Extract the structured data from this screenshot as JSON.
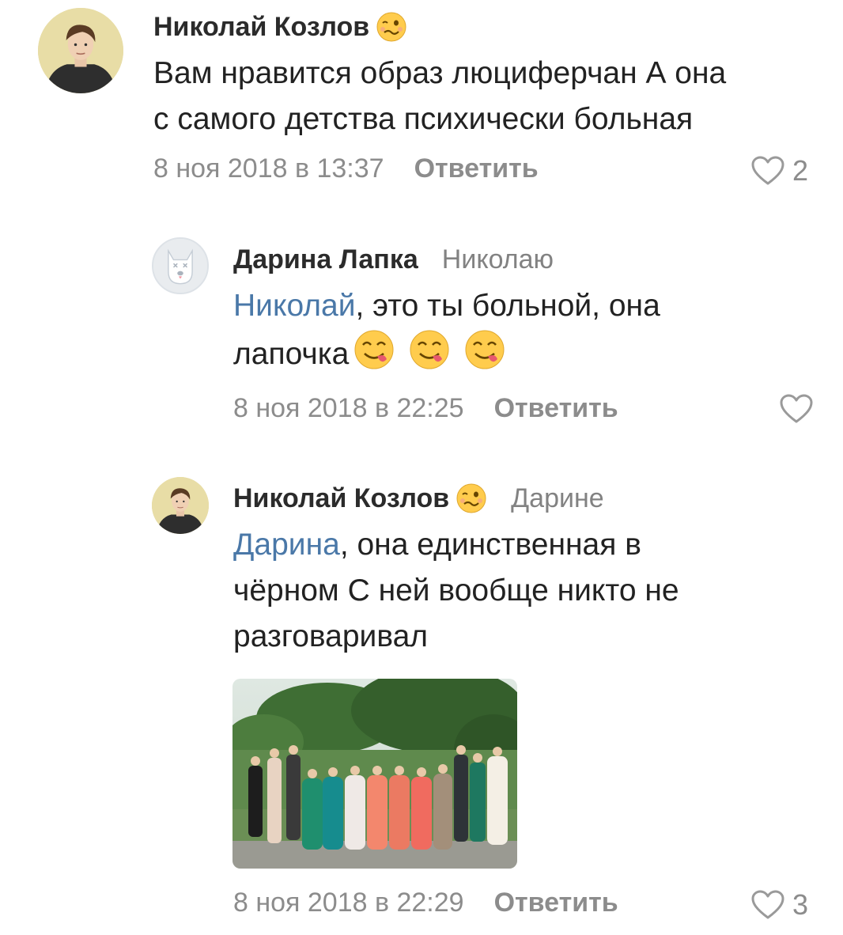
{
  "comments": [
    {
      "author": "Николай Козлов",
      "status_emoji": "woozy-face-emoji",
      "reply_to": "",
      "text_lines": [
        "Вам нравится образ люциферчан А она",
        "с самого детства психически больная"
      ],
      "date": "8 ноя 2018 в 13:37",
      "reply_label": "Ответить",
      "likes": "2"
    },
    {
      "author": "Дарина Лапка",
      "reply_to": "Николаю",
      "mention": "Николай",
      "text_rest_1": ", это ты больной, она",
      "text_line_2": "лапочка",
      "text_emojis": [
        "yum-face-emoji",
        "yum-face-emoji",
        "yum-face-emoji"
      ],
      "date": "8 ноя 2018 в 22:25",
      "reply_label": "Ответить",
      "likes": ""
    },
    {
      "author": "Николай Козлов",
      "status_emoji": "woozy-face-emoji",
      "reply_to": "Дарине",
      "mention": "Дарина",
      "text_rest_1": ", она единственная в",
      "text_line_2": "чёрном С ней вообще никто не",
      "text_line_3": "разговаривал",
      "attachment": "group-photo",
      "date": "8 ноя 2018 в 22:29",
      "reply_label": "Ответить",
      "likes": "3"
    }
  ],
  "colors": {
    "author": "#2b2b2b",
    "text": "#222222",
    "secondary": "#8c8c8c",
    "mention": "#4a78a8"
  },
  "icons": {
    "like": "heart-outline-icon",
    "placeholder_avatar": "dog-avatar-icon"
  }
}
